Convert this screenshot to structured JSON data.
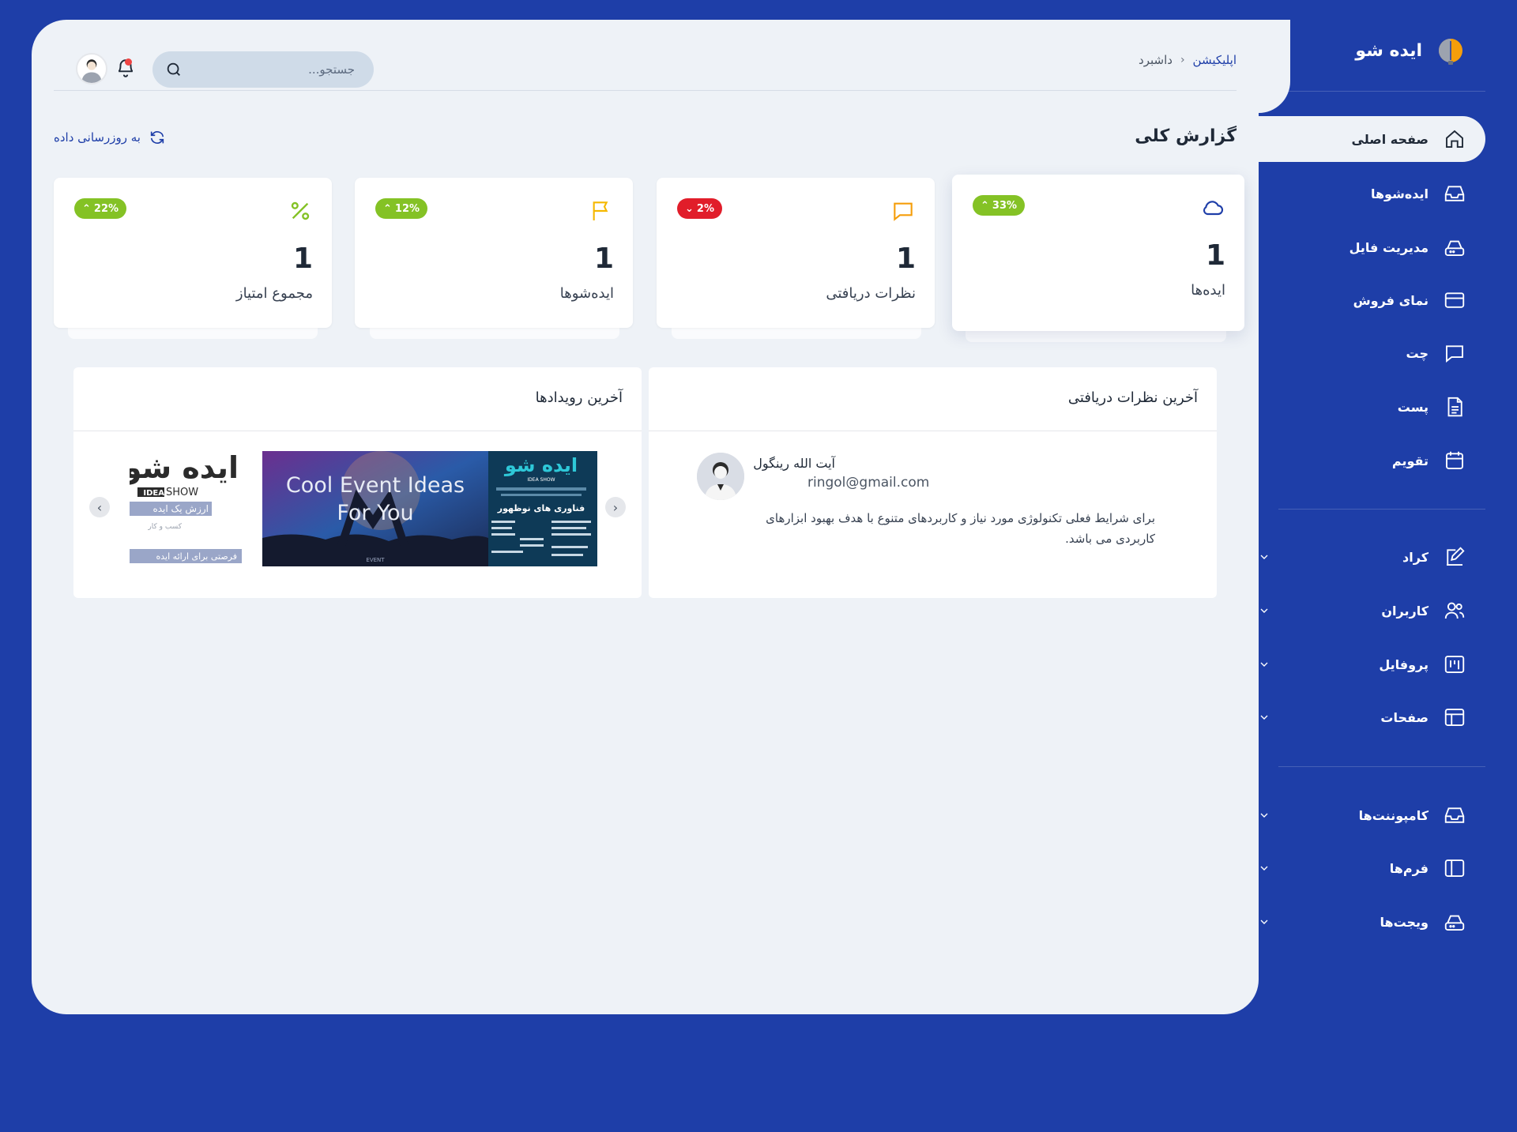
{
  "brand": {
    "name": "ایده شو"
  },
  "nav": {
    "items": [
      {
        "label": "صفحه اصلی",
        "icon": "home-icon",
        "active": true
      },
      {
        "label": "ایده‌شوها",
        "icon": "inbox-icon"
      },
      {
        "label": "مدیریت فایل",
        "icon": "drive-icon"
      },
      {
        "label": "نمای فروش",
        "icon": "credit-card-icon"
      },
      {
        "label": "چت",
        "icon": "chat-icon"
      },
      {
        "label": "پست",
        "icon": "document-icon"
      },
      {
        "label": "تقویم",
        "icon": "calendar-icon"
      }
    ],
    "groups": [
      {
        "label": "کراد",
        "icon": "edit-icon"
      },
      {
        "label": "کاربران",
        "icon": "users-icon"
      },
      {
        "label": "پروفایل",
        "icon": "kanban-icon"
      },
      {
        "label": "صفحات",
        "icon": "layout-icon"
      }
    ],
    "groups2": [
      {
        "label": "کامپوننت‌ها",
        "icon": "inbox-icon"
      },
      {
        "label": "فرم‌ها",
        "icon": "sidebar-layout-icon"
      },
      {
        "label": "ویجت‌ها",
        "icon": "drive-icon"
      }
    ]
  },
  "header": {
    "breadcrumb": [
      "اپلیکیشن",
      "داشبرد"
    ],
    "search_placeholder": "جستجو..."
  },
  "overview": {
    "title": "گزارش کلی",
    "refresh_label": "به روزرسانی داده"
  },
  "stats": [
    {
      "label": "ایده‌ها",
      "value": "1",
      "change": "33%",
      "trend": "up",
      "icon": "cloud-icon",
      "color": "#1e3ea8"
    },
    {
      "label": "نظرات دریافتی",
      "value": "1",
      "change": "2%",
      "trend": "down",
      "icon": "message-icon",
      "color": "#f59e0b"
    },
    {
      "label": "ایده‌شوها",
      "value": "1",
      "change": "12%",
      "trend": "up",
      "icon": "flag-icon",
      "color": "#f5b800"
    },
    {
      "label": "مجموع امتیاز",
      "value": "1",
      "change": "22%",
      "trend": "up",
      "icon": "percent-icon",
      "color": "#84c225"
    }
  ],
  "comments_panel": {
    "title": "آخرین نظرات دریافتی",
    "name": "آیت الله رینگول",
    "email": "ringol@gmail.com",
    "text": "برای شرایط فعلی تکنولوژی مورد نیاز و کاربردهای متنوع با هدف بهبود ابزارهای کاربردی می باشد."
  },
  "events_panel": {
    "title": "آخرین رویدادها",
    "slides": [
      {
        "headline": "ایده شو",
        "sub": "IDEA SHOW",
        "line": "فناوری های نوظهور"
      },
      {
        "headline": "Cool Event Ideas For You",
        "sub": "EVENT"
      },
      {
        "headline": "ایده شو",
        "sub": "IDEA SHOW",
        "line1": "ارزش یک ایده",
        "line2": "کسب و کار",
        "line3": "فرصتی برای ارائه ایده"
      }
    ]
  }
}
